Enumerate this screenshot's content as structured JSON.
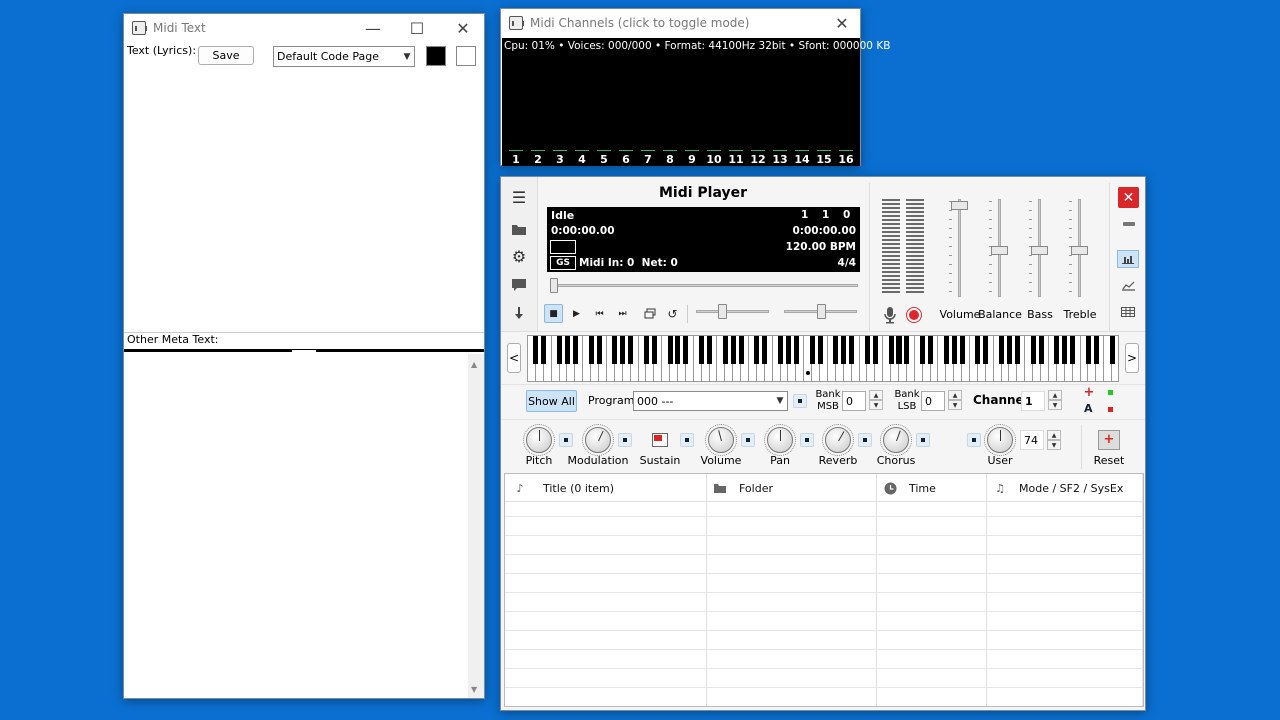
{
  "midi_text": {
    "title": "Midi Text",
    "lyrics_label": "Text (Lyrics):",
    "save_label": "Save",
    "code_page": "Default Code Page",
    "other_meta_label": "Other Meta Text:"
  },
  "midi_channels": {
    "title": "Midi Channels (click to toggle mode)",
    "status": "Cpu: 01% • Voices: 000/000 • Format: 44100Hz 32bit • Sfont: 000000 KB",
    "channels": [
      "1",
      "2",
      "3",
      "4",
      "5",
      "6",
      "7",
      "8",
      "9",
      "10",
      "11",
      "12",
      "13",
      "14",
      "15",
      "16"
    ]
  },
  "midi_player": {
    "title": "Midi Player",
    "display": {
      "state": "Idle",
      "pos1": "1",
      "pos2": "1",
      "pos3": "0",
      "time_elapsed": "0:00:00.00",
      "time_total": "0:00:00.00",
      "bpm": "120.00 BPM",
      "mode_badge": "GS",
      "midi_info": "Midi In: 0  Net: 0",
      "time_sig": "4/4"
    },
    "faders": [
      "Volume",
      "Balance",
      "Bass",
      "Treble"
    ],
    "show_all": "Show All",
    "program_label": "Program",
    "program_value": "000 ---",
    "bank_msb_label": "Bank MSB",
    "bank_msb_value": "0",
    "bank_lsb_label": "Bank LSB",
    "bank_lsb_value": "0",
    "channel_label": "Channel",
    "channel_value": "1",
    "a_label": "A",
    "knobs": [
      "Pitch",
      "Modulation",
      "Sustain",
      "Volume",
      "Pan",
      "Reverb",
      "Chorus",
      "User",
      "Reset"
    ],
    "user_value": "74",
    "nav_left": "<",
    "nav_right": ">",
    "columns": [
      "Title (0 item)",
      "Folder",
      "Time",
      "Mode / SF2 / SysEx"
    ]
  },
  "colors": {
    "desktop": "#0a6fd1",
    "close_red": "#d9262b",
    "record_red": "#e0262b",
    "lcd_bg": "#000000"
  }
}
